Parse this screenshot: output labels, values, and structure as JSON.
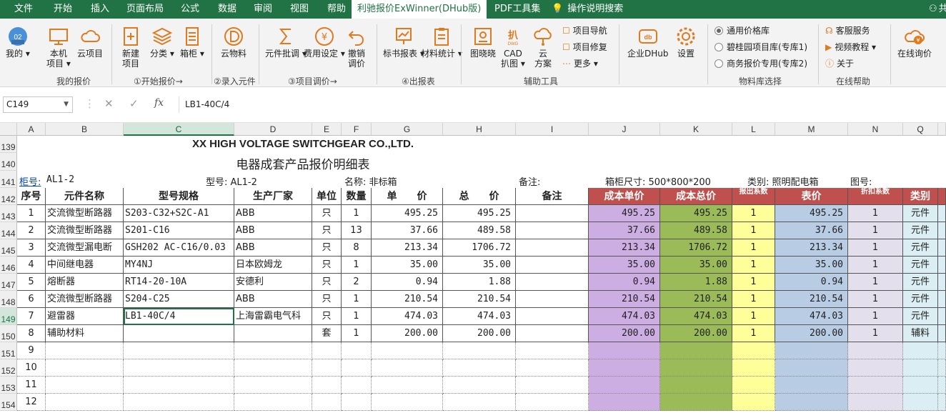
{
  "menu": [
    "文件",
    "开始",
    "插入",
    "页面布局",
    "公式",
    "数据",
    "审阅",
    "视图",
    "帮助",
    "利驰报价ExWinner(DHub版)",
    "PDF工具集",
    "操作说明搜索"
  ],
  "share": "共",
  "ribbon": {
    "my": "我的",
    "local": "本机\n项目",
    "cloud_proj": "云项目",
    "group_mine": "我的报价",
    "new": "新建\n项目",
    "cat": "分类",
    "cabinet": "箱柜",
    "group_start": "①开始报价→",
    "cloud_mat": "云物料",
    "group_entry": "②录入元件",
    "batch": "元件批调",
    "fee": "费用设定",
    "undo": "撤销\n调价",
    "group_adjust": "③项目调价→",
    "bid": "标书报表",
    "mat_stat": "材料统计",
    "group_out": "④出报表",
    "tuxiao": "图晓晓",
    "cad": "CAD\n扒图",
    "yun": "云\n方案",
    "nav": "项目导航",
    "repair": "项目修复",
    "more": "更多",
    "group_aux": "辅助工具",
    "dhub": "企业DHub",
    "settings": "设置",
    "lib1": "通用价格库",
    "lib2": "碧桂园项目库(专库1)",
    "lib3": "商务报价专用(专库2)",
    "group_lib": "物料库选择",
    "service": "客服服务",
    "video": "视频教程",
    "about": "关于",
    "group_help": "在线帮助",
    "inquiry": "在线询价"
  },
  "formula": {
    "namebox": "C149",
    "value": "LB1-40C/4"
  },
  "columns": [
    "A",
    "B",
    "C",
    "D",
    "E",
    "F",
    "G",
    "H",
    "I",
    "J",
    "K",
    "L",
    "M",
    "N",
    "Q"
  ],
  "rownums": [
    "139",
    "140",
    "141",
    "142",
    "143",
    "144",
    "145",
    "146",
    "147",
    "148",
    "149",
    "150",
    "151",
    "152",
    "153",
    "154"
  ],
  "sheet": {
    "company": "XX HIGH VOLTAGE SWITCHGEAR CO.,LTD.",
    "subtitle": "电器成套产品报价明细表",
    "cabinet_label": "柜号:",
    "cabinet_val": "AL1-2",
    "model_label": "型号: AL1-2",
    "name_label": "名称: 非标箱",
    "note_label": "备注:",
    "size_label": "箱柜尺寸: 500*800*200",
    "type_label": "类别: 照明配电箱",
    "drawing_label": "图号:",
    "headers": [
      "序号",
      "元件名称",
      "型号规格",
      "生产厂家",
      "单位",
      "数量",
      "单　　价",
      "总　　价",
      "备注",
      "成本单价",
      "成本总价",
      "报出系数",
      "表价",
      "折扣系数",
      "类别"
    ],
    "rows": [
      [
        "1",
        "交流微型断路器",
        "S203-C32+S2C-A1",
        "ABB",
        "只",
        "1",
        "495.25",
        "495.25",
        "",
        "495.25",
        "495.25",
        "1",
        "495.25",
        "1",
        "元件"
      ],
      [
        "2",
        "交流微型断路器",
        "S201-C16",
        "ABB",
        "只",
        "13",
        "37.66",
        "489.58",
        "",
        "37.66",
        "489.58",
        "1",
        "37.66",
        "1",
        "元件"
      ],
      [
        "3",
        "交流微型漏电断",
        "GSH202 AC-C16/0.03",
        "ABB",
        "只",
        "8",
        "213.34",
        "1706.72",
        "",
        "213.34",
        "1706.72",
        "1",
        "213.34",
        "1",
        "元件"
      ],
      [
        "4",
        "中间继电器",
        "MY4NJ",
        "日本欧姆龙",
        "只",
        "1",
        "35.00",
        "35.00",
        "",
        "35.00",
        "35.00",
        "1",
        "35.00",
        "1",
        "元件"
      ],
      [
        "5",
        "熔断器",
        "RT14-20-10A",
        "安德利",
        "只",
        "2",
        "0.94",
        "1.88",
        "",
        "0.94",
        "1.88",
        "1",
        "0.94",
        "1",
        "元件"
      ],
      [
        "6",
        "交流微型断路器",
        "S204-C25",
        "ABB",
        "只",
        "1",
        "210.54",
        "210.54",
        "",
        "210.54",
        "210.54",
        "1",
        "210.54",
        "1",
        "元件"
      ],
      [
        "7",
        "避雷器",
        "LB1-40C/4",
        "上海雷霸电气科",
        "只",
        "1",
        "474.03",
        "474.03",
        "",
        "474.03",
        "474.03",
        "1",
        "474.03",
        "1",
        "元件"
      ],
      [
        "8",
        "辅助材料",
        "",
        "",
        "套",
        "1",
        "200.00",
        "200.00",
        "",
        "200.00",
        "200.00",
        "1",
        "200.00",
        "1",
        "辅料"
      ],
      [
        "9",
        "",
        "",
        "",
        "",
        "",
        "",
        "",
        "",
        "",
        "",
        "",
        "",
        "",
        ""
      ],
      [
        "10",
        "",
        "",
        "",
        "",
        "",
        "",
        "",
        "",
        "",
        "",
        "",
        "",
        "",
        ""
      ],
      [
        "11",
        "",
        "",
        "",
        "",
        "",
        "",
        "",
        "",
        "",
        "",
        "",
        "",
        "",
        ""
      ],
      [
        "12",
        "",
        "",
        "",
        "",
        "",
        "",
        "",
        "",
        "",
        "",
        "",
        "",
        "",
        ""
      ]
    ]
  },
  "colors": {
    "accent": "#217346",
    "cost_unit": "#cdaee3",
    "cost_total": "#9bbb59",
    "factor": "#ffff99",
    "list_price": "#b8cce4",
    "discount": "#e4dfec",
    "category": "#daeef3",
    "header_red": "#c0504d"
  }
}
